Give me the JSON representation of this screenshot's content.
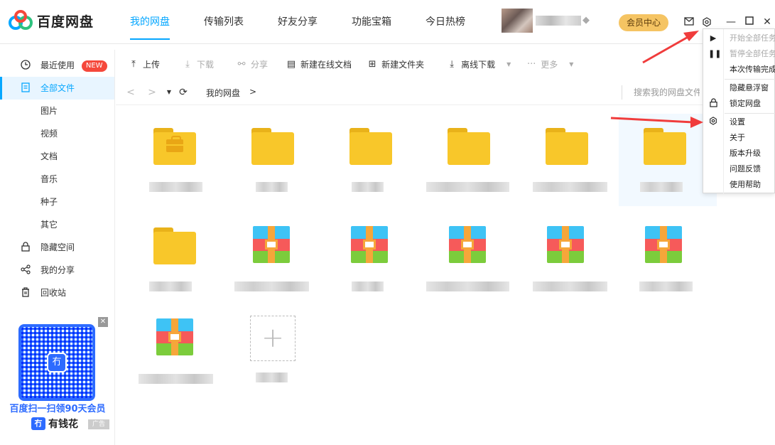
{
  "app": {
    "title": "百度网盘"
  },
  "nav": {
    "items": [
      "我的网盘",
      "传输列表",
      "好友分享",
      "功能宝箱",
      "今日热榜"
    ]
  },
  "header": {
    "vip_label": "会员中心"
  },
  "sidebar": {
    "items": [
      {
        "label": "最近使用",
        "icon": "clock-icon",
        "badge": "NEW"
      },
      {
        "label": "全部文件",
        "icon": "document-icon"
      },
      {
        "label": "图片"
      },
      {
        "label": "视频"
      },
      {
        "label": "文档"
      },
      {
        "label": "音乐"
      },
      {
        "label": "种子"
      },
      {
        "label": "其它"
      },
      {
        "label": "隐藏空间",
        "icon": "lock-icon"
      },
      {
        "label": "我的分享",
        "icon": "share-icon"
      },
      {
        "label": "回收站",
        "icon": "trash-icon"
      }
    ],
    "ad": {
      "text": "百度扫一扫领90天会员",
      "brand": "有钱花",
      "brand_mark": "冇",
      "tag": "广告"
    }
  },
  "toolbar": {
    "upload": "上传",
    "download": "下载",
    "share": "分享",
    "new_doc": "新建在线文档",
    "new_folder": "新建文件夹",
    "offline_download": "离线下载",
    "more": "更多"
  },
  "breadcrumb": {
    "root": "我的网盘",
    "separator": ">"
  },
  "search": {
    "placeholder": "搜索我的网盘文件"
  },
  "menu": {
    "items": [
      {
        "label": "开始全部任务",
        "disabled": true,
        "icon": "play-icon"
      },
      {
        "label": "暂停全部任务",
        "disabled": true,
        "icon": "pause-icon"
      },
      {
        "label": "本次传输完成后关机"
      },
      {
        "label": "隐藏悬浮窗"
      },
      {
        "label": "锁定网盘",
        "icon": "lock-icon"
      },
      {
        "label": "设置",
        "icon": "gear-icon"
      },
      {
        "label": "关于"
      },
      {
        "label": "版本升级"
      },
      {
        "label": "问题反馈"
      },
      {
        "label": "使用帮助"
      }
    ]
  },
  "colors": {
    "accent": "#06a7ff",
    "vip": "#f5c463",
    "folder": "#f8c72a",
    "annotation_arrow": "#f03c3c"
  }
}
